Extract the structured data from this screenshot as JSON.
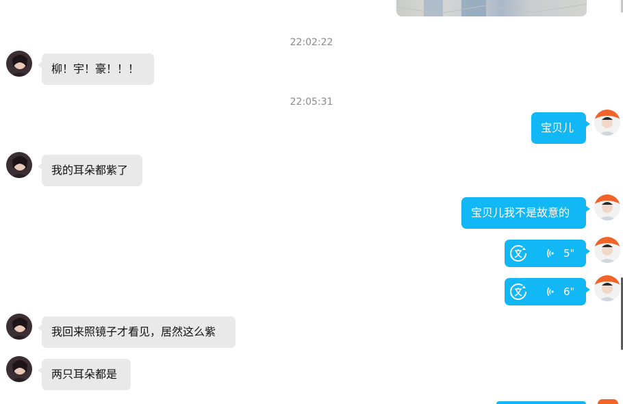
{
  "messages": {
    "ts1": "22:02:22",
    "ts2": "22:05:31",
    "m1": "柳！宇！豪！！！",
    "m2": "宝贝儿",
    "m3": "我的耳朵都紫了",
    "m4": "宝贝儿我不是故意的",
    "voice1_duration": "5\"",
    "voice2_duration": "6\"",
    "m5": "我回来照镜子才看见，居然这么紫",
    "m6": "两只耳朵都是"
  },
  "colors": {
    "outgoing_bubble": "#12b7f5",
    "incoming_bubble": "#e9e9e9",
    "timestamp": "#8a8a8a"
  },
  "icons": {
    "voice_translate": "translate-icon",
    "voice_wave": "voice-wave-icon"
  }
}
